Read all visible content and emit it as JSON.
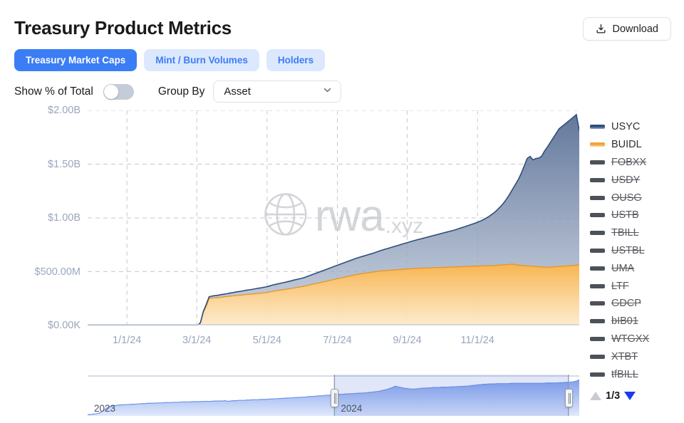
{
  "header": {
    "title": "Treasury Product Metrics",
    "download_label": "Download",
    "download_icon": "download-tray-icon"
  },
  "tabs": [
    {
      "label": "Treasury Market Caps",
      "active": true
    },
    {
      "label": "Mint / Burn Volumes",
      "active": false
    },
    {
      "label": "Holders",
      "active": false
    }
  ],
  "controls": {
    "toggle_label": "Show % of Total",
    "toggle_on": false,
    "groupby_label": "Group By",
    "groupby_value": "Asset",
    "groupby_icon": "chevron-down-icon"
  },
  "watermark": {
    "text": "rwa",
    "suffix": ".xyz",
    "icon": "globe-icon"
  },
  "legend": {
    "items": [
      {
        "label": "USYC",
        "color": "#3f5f8f",
        "enabled": true
      },
      {
        "label": "BUIDL",
        "color": "#f5a93c",
        "enabled": true
      },
      {
        "label": "FOBXX",
        "color": "#4d5259",
        "enabled": false
      },
      {
        "label": "USDY",
        "color": "#4d5259",
        "enabled": false
      },
      {
        "label": "OUSG",
        "color": "#4d5259",
        "enabled": false
      },
      {
        "label": "USTB",
        "color": "#4d5259",
        "enabled": false
      },
      {
        "label": "TBILL",
        "color": "#4d5259",
        "enabled": false
      },
      {
        "label": "USTBL",
        "color": "#4d5259",
        "enabled": false
      },
      {
        "label": "UMA",
        "color": "#4d5259",
        "enabled": false
      },
      {
        "label": "LTF",
        "color": "#4d5259",
        "enabled": false
      },
      {
        "label": "GDCP",
        "color": "#4d5259",
        "enabled": false
      },
      {
        "label": "bIB01",
        "color": "#4d5259",
        "enabled": false
      },
      {
        "label": "WTGXX",
        "color": "#4d5259",
        "enabled": false
      },
      {
        "label": "XTBT",
        "color": "#4d5259",
        "enabled": false
      },
      {
        "label": "tfBILL",
        "color": "#4d5259",
        "enabled": false
      }
    ],
    "page_indicator": "1/3",
    "prev_icon": "triangle-up-icon",
    "next_icon": "triangle-down-icon"
  },
  "brush": {
    "year_left": "2023",
    "year_right": "2024",
    "handle_left_pct": 50.2,
    "handle_right_pct": 97.8
  },
  "chart_data": {
    "type": "area",
    "title": "Treasury Product Metrics",
    "stacked": true,
    "xlabel": "",
    "ylabel": "",
    "ylim": [
      0,
      2000000000
    ],
    "yticks": [
      0,
      500000000,
      1000000000,
      1500000000,
      2000000000
    ],
    "ytick_labels": [
      "$0.00K",
      "$500.00M",
      "$1.00B",
      "$1.50B",
      "$2.00B"
    ],
    "xticks": [
      "1/1/24",
      "3/1/24",
      "5/1/24",
      "7/1/24",
      "9/1/24",
      "11/1/24"
    ],
    "xtick_pos_pct": [
      8.0,
      22.2,
      36.5,
      50.8,
      65.0,
      79.3
    ],
    "grid": "dashed",
    "legend_position": "right",
    "colors": {
      "USYC": "#3f5f8f",
      "BUIDL": "#f5a93c"
    },
    "series": [
      {
        "name": "BUIDL",
        "color": "#f5a93c",
        "values": [
          0,
          0,
          0,
          0,
          0,
          0,
          0,
          0,
          0,
          0,
          0,
          0,
          0,
          0,
          0,
          0,
          0,
          0,
          0,
          0,
          0,
          0,
          0,
          0,
          0,
          0,
          0,
          0,
          0,
          0,
          0,
          0,
          0,
          0,
          0,
          0,
          0,
          0,
          0,
          20,
          120,
          180,
          250,
          255,
          258,
          258,
          262,
          265,
          268,
          272,
          274,
          278,
          280,
          282,
          285,
          288,
          290,
          292,
          295,
          298,
          300,
          303,
          306,
          312,
          318,
          322,
          326,
          330,
          334,
          338,
          342,
          348,
          352,
          356,
          360,
          366,
          372,
          378,
          384,
          390,
          396,
          402,
          408,
          414,
          420,
          426,
          432,
          438,
          444,
          450,
          456,
          462,
          468,
          474,
          478,
          482,
          486,
          490,
          494,
          498,
          502,
          506,
          508,
          510,
          512,
          514,
          516,
          518,
          520,
          522,
          524,
          526,
          528,
          530,
          531,
          532,
          533,
          534,
          535,
          536,
          537,
          538,
          539,
          540,
          541,
          542,
          543,
          544,
          545,
          546,
          547,
          548,
          549,
          550,
          551,
          552,
          553,
          554,
          555,
          556,
          557,
          558,
          560,
          562,
          564,
          566,
          568,
          570,
          565,
          560,
          558,
          556,
          554,
          552,
          550,
          548,
          546,
          544,
          542,
          540,
          542,
          544,
          546,
          548,
          550,
          552,
          554,
          556,
          558,
          560,
          562
        ]
      },
      {
        "name": "USYC",
        "color": "#3f5f8f",
        "values": [
          0,
          0,
          0,
          0,
          0,
          0,
          0,
          0,
          0,
          0,
          0,
          0,
          0,
          0,
          0,
          0,
          0,
          0,
          0,
          0,
          0,
          0,
          0,
          0,
          0,
          0,
          0,
          0,
          0,
          0,
          0,
          0,
          0,
          0,
          0,
          0,
          0,
          0,
          0,
          6,
          10,
          14,
          16,
          18,
          20,
          22,
          24,
          25,
          26,
          28,
          30,
          32,
          34,
          36,
          38,
          40,
          42,
          44,
          46,
          48,
          50,
          52,
          54,
          56,
          58,
          60,
          62,
          64,
          66,
          68,
          70,
          72,
          74,
          76,
          78,
          80,
          84,
          88,
          92,
          96,
          100,
          104,
          108,
          112,
          116,
          120,
          124,
          128,
          132,
          136,
          140,
          144,
          148,
          152,
          156,
          160,
          164,
          168,
          172,
          176,
          182,
          188,
          194,
          200,
          206,
          212,
          218,
          224,
          230,
          236,
          242,
          248,
          254,
          260,
          266,
          272,
          278,
          284,
          290,
          296,
          302,
          308,
          314,
          320,
          326,
          332,
          338,
          344,
          352,
          360,
          368,
          376,
          384,
          392,
          400,
          410,
          420,
          432,
          446,
          462,
          480,
          500,
          524,
          550,
          580,
          615,
          655,
          700,
          750,
          800,
          860,
          930,
          1000,
          1020,
          990,
          1005,
          1010,
          1030,
          1080,
          1120,
          1160,
          1200,
          1240,
          1280,
          1300,
          1320,
          1340,
          1360,
          1380,
          1400,
          1250
        ]
      }
    ],
    "navigator": {
      "type": "area",
      "color": "#6f93e8",
      "selection_start_pct": 50.2,
      "selection_end_pct": 97.8,
      "values": [
        2,
        2,
        3,
        4,
        6,
        10,
        16,
        22,
        26,
        28,
        30,
        31,
        32,
        32,
        33,
        33,
        34,
        34,
        35,
        35,
        36,
        36,
        37,
        37,
        37,
        38,
        38,
        38,
        39,
        39,
        39,
        40,
        40,
        40,
        41,
        41,
        41,
        41,
        42,
        42,
        42,
        42,
        43,
        43,
        43,
        43,
        44,
        44,
        44,
        44,
        45,
        43,
        44,
        45,
        45,
        46,
        46,
        46,
        47,
        47,
        48,
        48,
        48,
        49,
        49,
        49,
        50,
        50,
        51,
        51,
        52,
        52,
        53,
        53,
        54,
        54,
        55,
        55,
        56,
        56,
        57,
        58,
        58,
        59,
        60,
        60,
        61,
        62,
        62,
        63,
        64,
        64,
        65,
        65,
        66,
        66,
        67,
        67,
        68,
        68,
        69,
        69,
        70,
        71,
        72,
        73,
        74,
        76,
        78,
        80,
        83,
        86,
        90,
        88,
        86,
        84,
        83,
        82,
        81,
        81,
        82,
        83,
        84,
        84,
        85,
        85,
        86,
        86,
        86,
        87,
        87,
        87,
        88,
        88,
        88,
        89,
        89,
        90,
        90,
        91,
        92,
        93,
        94,
        95,
        96,
        96,
        97,
        97,
        97,
        98,
        98,
        98,
        98,
        98,
        99,
        99,
        99,
        99,
        99,
        99,
        99,
        99,
        99,
        99,
        99,
        99,
        99,
        100,
        100,
        100,
        100,
        100,
        101,
        101,
        102,
        102,
        103,
        104,
        106,
        110
      ]
    }
  }
}
